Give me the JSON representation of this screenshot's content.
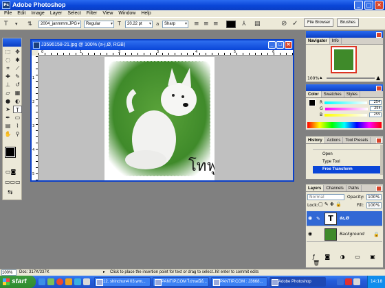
{
  "app": {
    "title": "Adobe Photoshop",
    "icon_label": "Ps"
  },
  "menu": [
    "File",
    "Edit",
    "Image",
    "Layer",
    "Select",
    "Filter",
    "View",
    "Window",
    "Help"
  ],
  "options": {
    "font_family": "2004_janmmm.JPG",
    "font_style": "Regular",
    "font_size": "20.22 pt",
    "aa_label": "a",
    "antialias": "Sharp",
    "text_color": "#000000"
  },
  "palette_well": {
    "tabs": [
      "File Browser",
      "Brushes"
    ]
  },
  "document": {
    "title": "J3596158-21.jpg @ 100% (ล-j,Ø, RGB)",
    "overlay_text": "โทฟู",
    "ruler_top": [
      "0",
      "1",
      "2",
      "3",
      "4",
      "5",
      "6"
    ],
    "ruler_left": [
      "1",
      "2",
      "3",
      "4",
      "5"
    ]
  },
  "navigator": {
    "tabs": [
      "Navigator",
      "Info"
    ],
    "zoom": "100%"
  },
  "color": {
    "tabs": [
      "Color",
      "Swatches",
      "Styles"
    ],
    "channels": [
      {
        "label": "R",
        "value": "254",
        "color": "#ff2a2a"
      },
      {
        "label": "G",
        "value": "254",
        "color": "#c02ac0"
      },
      {
        "label": "B",
        "value": "255",
        "color": "#e0c000"
      }
    ]
  },
  "history": {
    "tabs": [
      "History",
      "Actions",
      "Tool Presets"
    ],
    "items": [
      {
        "label": "Open",
        "selected": false
      },
      {
        "label": "Type Tool",
        "selected": false
      },
      {
        "label": "Free Transform",
        "selected": true
      }
    ]
  },
  "layers": {
    "tabs": [
      "Layers",
      "Channels",
      "Paths"
    ],
    "blend": "Normal",
    "opacity_label": "Opacity:",
    "opacity": "100%",
    "lock_label": "Lock:",
    "fill_label": "Fill:",
    "fill": "100%",
    "items": [
      {
        "name": "ส่ง,Ø",
        "type": "text",
        "thumb": "T",
        "selected": true
      },
      {
        "name": "Background",
        "type": "image",
        "selected": false
      }
    ]
  },
  "status": {
    "zoom": "100%",
    "doc": "Doc: 317K/337K",
    "hint": "Click to place the insertion point for text or drag to select..hit enter to commit edits"
  },
  "taskbar": {
    "start": "start",
    "tasks": [
      {
        "label": "12. shinchun4 03.wm...",
        "active": false
      },
      {
        "label": "PANTIP.COM ไปรษณีย์...",
        "active": false
      },
      {
        "label": "PANTIP.COM : J3668...",
        "active": false
      },
      {
        "label": "Adobe Photoshop",
        "active": true
      }
    ],
    "clock": "14:18"
  }
}
